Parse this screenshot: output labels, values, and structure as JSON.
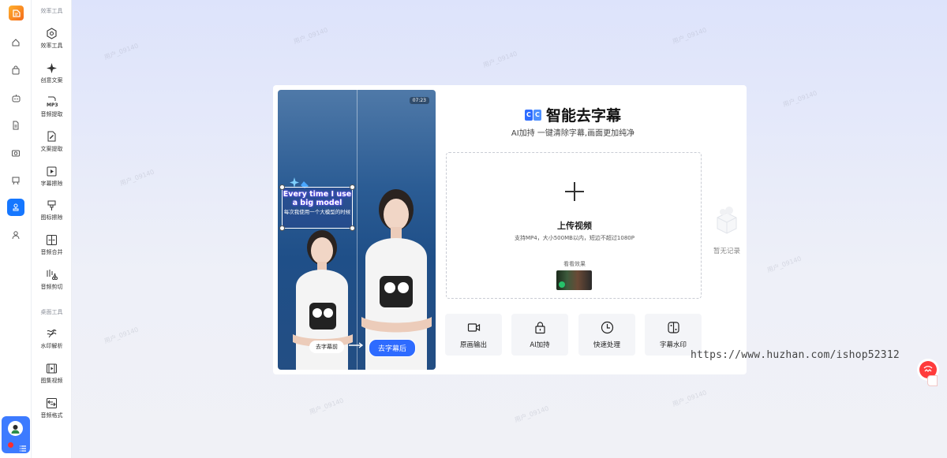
{
  "sidebar": {
    "rail_items": [
      "home",
      "bag",
      "robot",
      "file",
      "camera",
      "board",
      "stamp",
      "user"
    ],
    "active_index": 6
  },
  "tools": {
    "group1": "效率工具",
    "group2": "桌面工具",
    "items": [
      {
        "label": "效率工具",
        "icon": "hexagon-icon"
      },
      {
        "label": "创意文案",
        "icon": "sparkle-icon"
      },
      {
        "label": "音频提取",
        "icon": "mp3-icon"
      },
      {
        "label": "文案提取",
        "icon": "edit-doc-icon"
      },
      {
        "label": "字幕擦除",
        "icon": "play-doc-icon"
      },
      {
        "label": "图标擦除",
        "icon": "brush-icon"
      },
      {
        "label": "音频合并",
        "icon": "merge-icon"
      },
      {
        "label": "音频剪切",
        "icon": "scissors-icon"
      },
      {
        "label": "水印解析",
        "icon": "waves-icon"
      },
      {
        "label": "图集视频",
        "icon": "film-icon"
      },
      {
        "label": "音频格式",
        "icon": "convert-icon"
      }
    ]
  },
  "watermark": "用户_09140",
  "main": {
    "title": "智能去字幕",
    "cc_badge": [
      "C",
      "C"
    ],
    "subtitle": "AI加持 一键清除字幕,画面更加纯净",
    "preview": {
      "time": "07:23",
      "subtitle_en": "Every time I use a big model",
      "subtitle_zh": "每次我使用一个大模型的时候",
      "before_label": "去字幕前",
      "after_label": "去字幕后"
    },
    "upload": {
      "title": "上传视频",
      "hint": "支持MP4，大小500MB以内，短边不超过1080P",
      "example_label": "看看效果"
    },
    "features": [
      {
        "label": "原画输出",
        "icon": "video-camera-icon"
      },
      {
        "label": "AI加持",
        "icon": "lock-icon"
      },
      {
        "label": "快速处理",
        "icon": "clock-icon"
      },
      {
        "label": "字幕水印",
        "icon": "switch-icon"
      }
    ]
  },
  "history": {
    "empty_label": "暂无记录"
  },
  "overlay_url": "https://www.huzhan.com/ishop52312"
}
